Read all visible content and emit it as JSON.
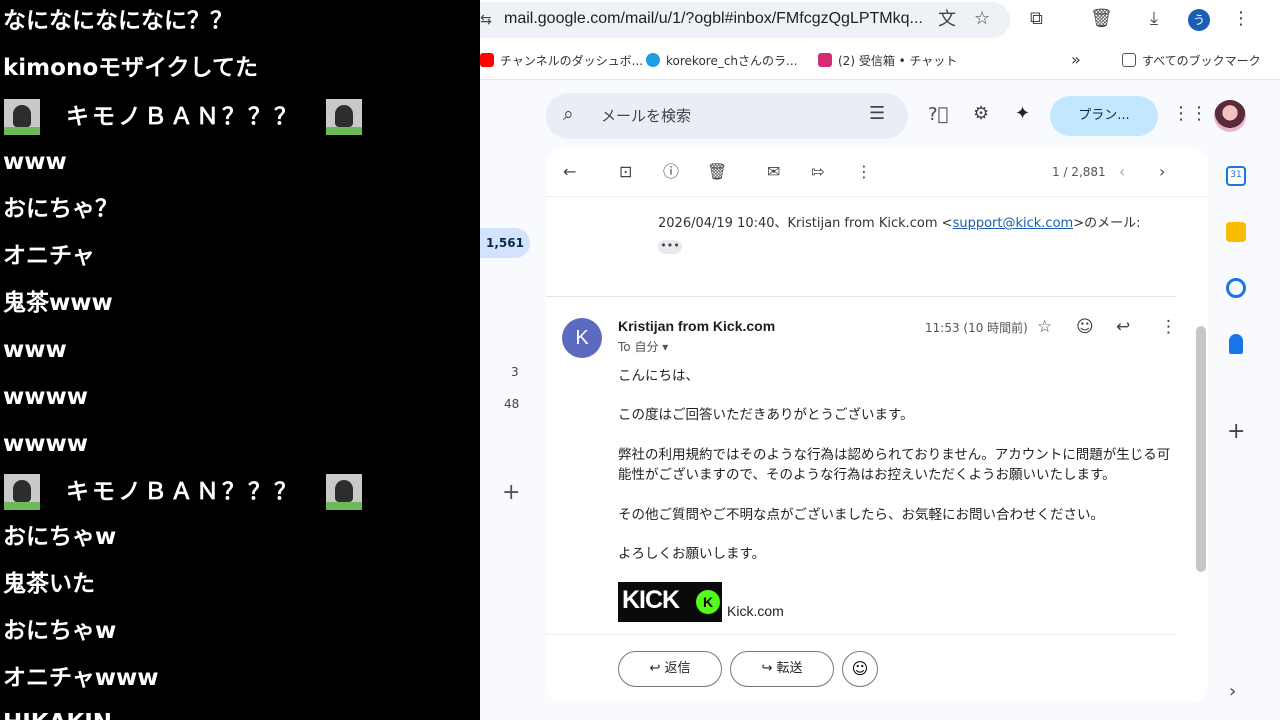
{
  "chat": {
    "lines": [
      "なになになになに？？",
      "kimonoモザイクしてた",
      "キモノＢＡＮ？？？",
      "www",
      "おにちゃ？",
      "オニチャ",
      "鬼茶www",
      "www",
      "wwww",
      "wwww",
      "キモノＢＡＮ？？？",
      "おにちゃw",
      "鬼茶いた",
      "おにちゃw",
      "オニチャwww",
      "HIKAKIN"
    ]
  },
  "browser": {
    "url": "mail.google.com/mail/u/1/?ogbl#inbox/FMfcgzQgLPTMkq...",
    "profile_initial": "う",
    "bookmarks": [
      {
        "label": "チャンネルのダッシュボ...",
        "color": "#ff0000"
      },
      {
        "label": "korekore_chさんのラ...",
        "color": "#1e9de1"
      },
      {
        "label": "(2) 受信箱 • チャット",
        "color": "#d62976"
      }
    ],
    "bookmarks_overflow": "»",
    "all_bookmarks": "すべてのブックマーク"
  },
  "gmail": {
    "search_placeholder": "メールを検索",
    "plan_button": "プラン...",
    "inbox_count": "1,561",
    "rail_counts": [
      "3",
      "48"
    ],
    "pager": "1 / 2,881",
    "quoted_prefix": "2026/04/19 10:40、Kristijan from Kick.com <",
    "quoted_email": "support@kick.com",
    "quoted_suffix": ">のメール:",
    "ellipsis": "•••",
    "sender_initial": "K",
    "sender_name": "Kristijan from Kick.com",
    "to_line": "To 自分 ▾",
    "time": "11:53 (10 時間前)",
    "body": [
      "こんにちは、",
      "この度はご回答いただきありがとうございます。",
      "弊社の利用規約ではそのような行為は認められておりません。アカウントに問題が生じる可能性がございますので、そのような行為はお控えいただくようお願いいたします。",
      "その他ご質問やご不明な点がございましたら、お気軽にお問い合わせください。",
      "よろしくお願いします。"
    ],
    "logo_text": "KICK",
    "logo_mark": "K",
    "logo_site": "Kick.com",
    "reply_button": "返信",
    "forward_button": "転送"
  },
  "colors": {
    "accent": "#0b57d0",
    "kick_green": "#53fc18",
    "plan_bg": "#c2e7ff"
  }
}
